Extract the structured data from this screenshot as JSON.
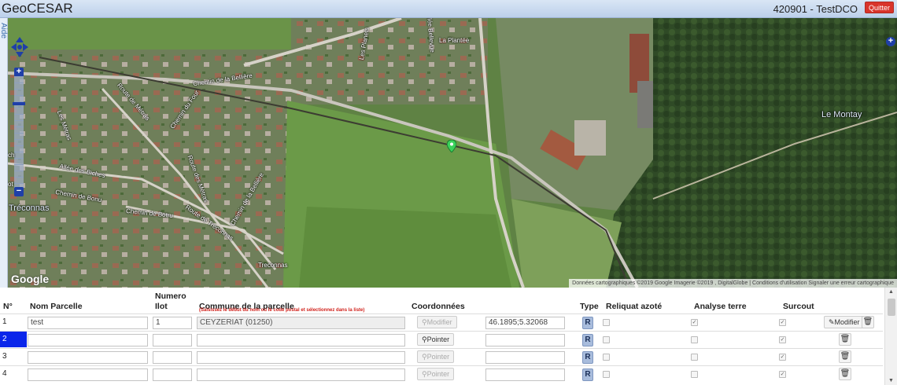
{
  "header": {
    "app_title": "GeoCESAR",
    "project": "420901 - TestDCO",
    "quit_label": "Quitter"
  },
  "map": {
    "aide_label": "Aide",
    "zoom_in": "+",
    "zoom_out": "−",
    "layer_switcher": "+",
    "place_labels": {
      "la_plantee": "La Plantée",
      "le_montay": "Le Montay",
      "treconnas_big": "e Tréconnas",
      "treconnas": "Treconnas"
    },
    "road_labels": {
      "chemin_belliere": "Chemin de la Bellière",
      "route_metras": "Route de Métras",
      "chemin_four": "Chemin du Four",
      "les_metras": "Les Métras",
      "allee_biches": "Allée des Biches",
      "chemin_de_bonu": "Chemin de Bonu",
      "chemin_botru": "Chemin de Botru",
      "route_treconnas": "Route de Treconnas",
      "route_des_metras": "Route des Métras",
      "chemin_belliere_2": "Chemin de la Bellière",
      "les_planets": "Les Planets",
      "allee_bellevue": "Allée Bellevue",
      "edge_ch": "ch",
      "edge_ot": "ot"
    },
    "google_logo": "Google",
    "attribution": "Données cartographiques ©2019 Google Imagerie ©2019 , DigitalGlobe  |  Conditions d'utilisation   Signaler une erreur cartographique"
  },
  "table": {
    "headers": {
      "num": "N°",
      "nom": "Nom Parcelle",
      "ilot_line1": "Numero",
      "ilot_line2": "Ilot",
      "commune": "Commune de la parcelle",
      "commune_hint": "(Saisissez le début du nom ou le code postal et sélectionnez dans la liste)",
      "coord": "Coordonnées",
      "type": "Type",
      "reliquat": "Reliquat azoté",
      "analyse": "Analyse terre",
      "surcout": "Surcout"
    },
    "rows": [
      {
        "num": "1",
        "nom": "test",
        "ilot": "1",
        "commune": "CEYZERIAT (01250)",
        "coord_btn": "Modifier",
        "coord": "46.1895;5.32068",
        "type": "R",
        "reliquat": "",
        "analyse": "✓",
        "surcout": "✓",
        "edit_label": "Modifier"
      },
      {
        "num": "2",
        "nom": "",
        "ilot": "",
        "commune": "",
        "coord_btn": "Pointer",
        "coord": "",
        "type": "R",
        "reliquat": "",
        "analyse": "",
        "surcout": "✓"
      },
      {
        "num": "3",
        "nom": "",
        "ilot": "",
        "commune": "",
        "coord_btn": "Pointer",
        "coord": "",
        "type": "R",
        "reliquat": "",
        "analyse": "",
        "surcout": "✓"
      },
      {
        "num": "4",
        "nom": "",
        "ilot": "",
        "commune": "",
        "coord_btn": "Pointer",
        "coord": "",
        "type": "R",
        "reliquat": "",
        "analyse": "",
        "surcout": "✓"
      }
    ]
  },
  "colors": {
    "selected_row": "#0a26ea",
    "quit_button": "#d9342b",
    "hint_text": "#d0201a",
    "map_control": "#1f3fa8"
  },
  "icons": {
    "pan": "pan-arrows-icon",
    "marker": "map-marker-icon",
    "pin": "pin-icon",
    "pencil": "pencil-icon",
    "trash": "trash-icon"
  }
}
